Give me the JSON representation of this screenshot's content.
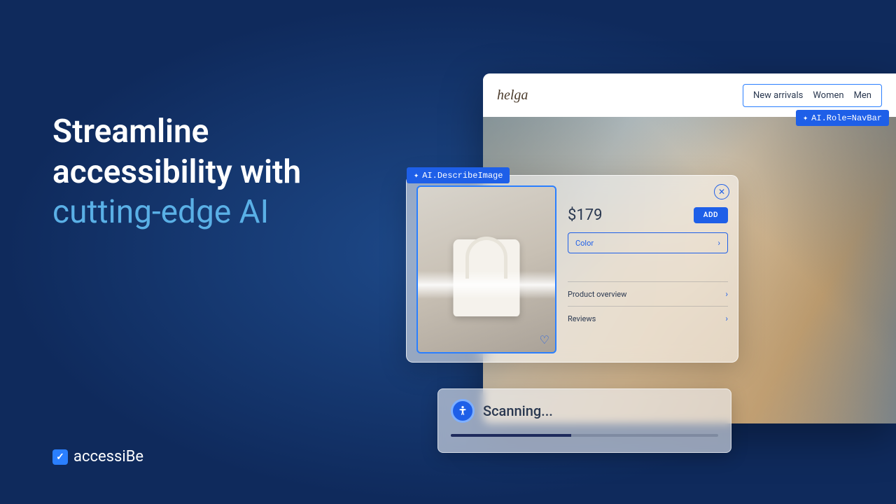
{
  "headline": {
    "line1": "Streamline accessibility with",
    "line2": "cutting-edge AI"
  },
  "brand": {
    "name": "accessiBe"
  },
  "site": {
    "logo": "helga",
    "nav": [
      "New arrivals",
      "Women",
      "Men"
    ],
    "nav_tag": "AI.Role=NavBar"
  },
  "product": {
    "describe_tag": "AI.DescribeImage",
    "price": "$179",
    "add_label": "ADD",
    "color_label": "Color",
    "rows": [
      "Product overview",
      "Reviews"
    ]
  },
  "scanning": {
    "label": "Scanning...",
    "progress_pct": 45
  }
}
